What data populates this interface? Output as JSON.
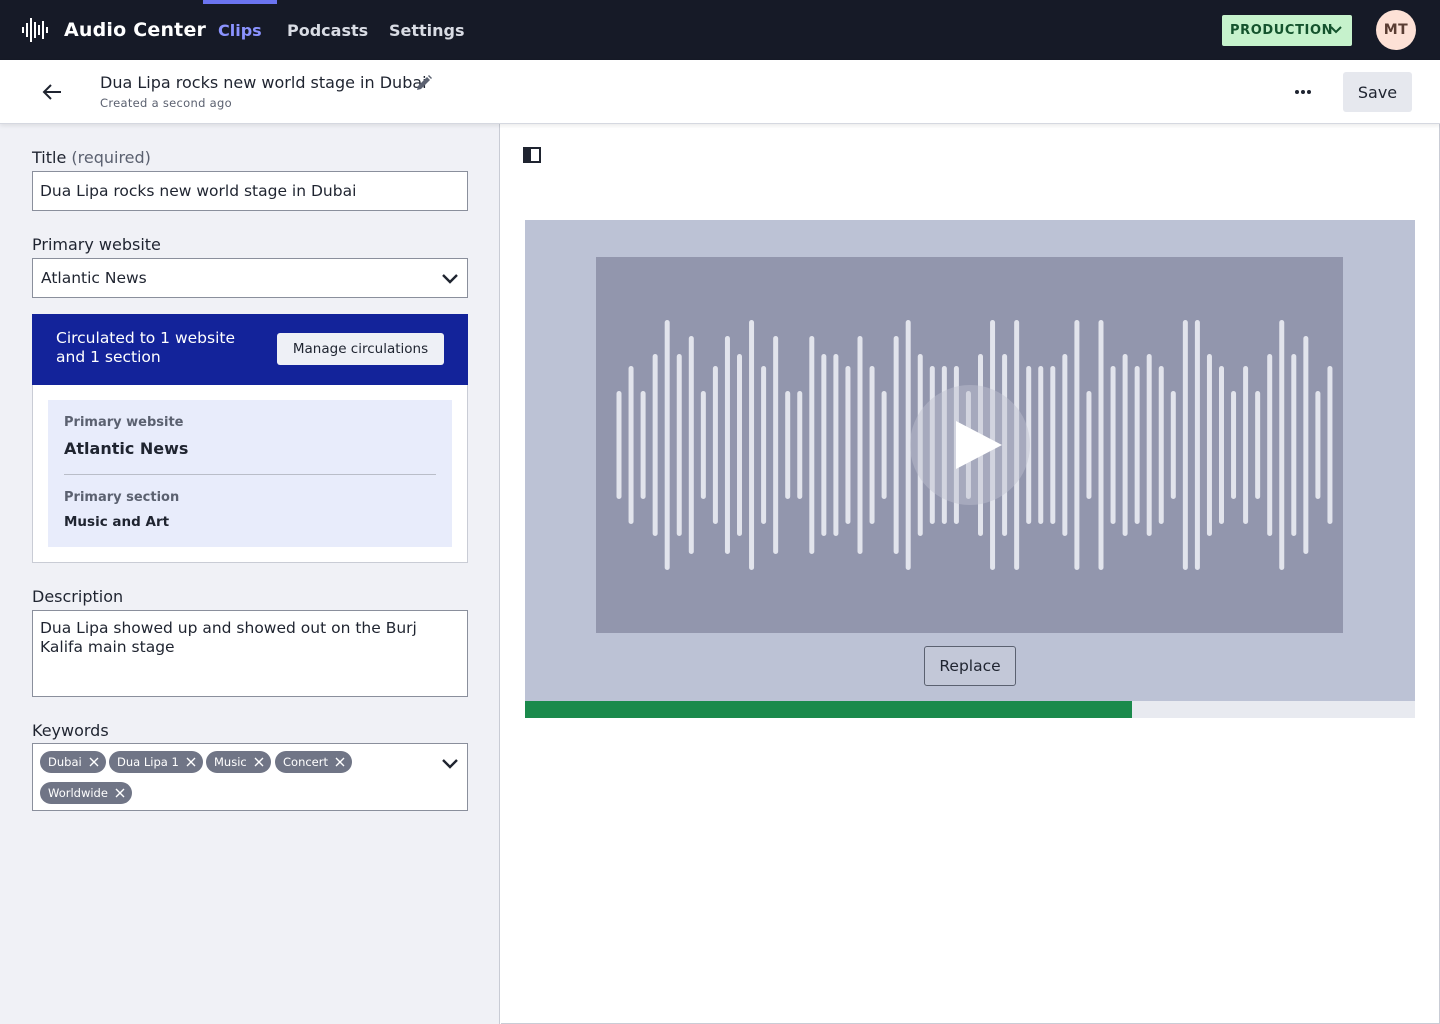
{
  "app": {
    "name": "Audio Center",
    "logo_icon": "audio-waveform-icon"
  },
  "nav": {
    "tabs": [
      {
        "label": "Clips",
        "active": true
      },
      {
        "label": "Podcasts",
        "active": false
      },
      {
        "label": "Settings",
        "active": false
      }
    ],
    "environment": "PRODUCTION",
    "user_initials": "MT"
  },
  "header": {
    "title": "Dua Lipa rocks new world stage in Dubai",
    "subtitle": "Created a second ago",
    "save_label": "Save"
  },
  "form": {
    "title_label": "Title",
    "title_required": "(required)",
    "title_value": "Dua Lipa rocks new world stage in Dubai",
    "primary_website_label": "Primary website",
    "primary_website_value": "Atlantic News",
    "circulation": {
      "summary": "Circulated to 1 website and 1 section",
      "manage_label": "Manage circulations",
      "primary_website_label": "Primary website",
      "primary_website_value": "Atlantic News",
      "primary_section_label": "Primary section",
      "primary_section_value": "Music and Art"
    },
    "description_label": "Description",
    "description_value": "Dua Lipa showed up and showed out on the Burj Kalifa main stage",
    "keywords_label": "Keywords",
    "keywords": [
      "Dubai",
      "Dua Lipa 1",
      "Music",
      "Concert",
      "Worldwide"
    ]
  },
  "media": {
    "replace_label": "Replace",
    "upload_progress": 0.682
  },
  "colors": {
    "nav_bg": "#161a27",
    "active_tab": "#8b93ff",
    "env_badge_bg": "#c6f2cc",
    "circulation_bg": "#13239a",
    "progress": "#1b8a4c"
  }
}
